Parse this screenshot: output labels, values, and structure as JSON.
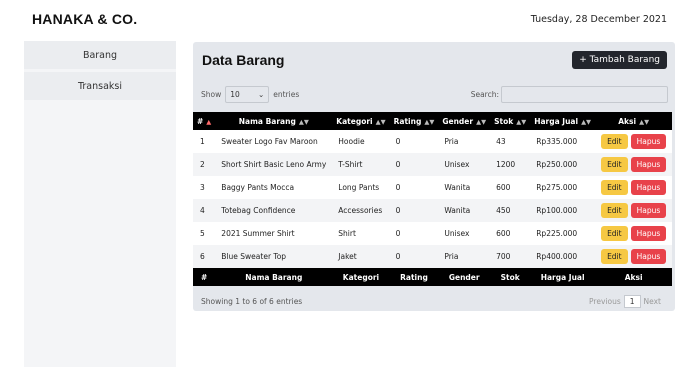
{
  "header": {
    "brand": "HANAKA & CO.",
    "date": "Tuesday, 28 December 2021"
  },
  "sidebar": {
    "items": [
      {
        "label": "Barang"
      },
      {
        "label": "Transaksi"
      }
    ]
  },
  "main": {
    "title": "Data Barang",
    "add_button": "+ Tambah Barang",
    "length": {
      "show": "Show",
      "value": "10",
      "entries": "entries"
    },
    "search_label": "Search:",
    "table": {
      "columns": [
        "#",
        "Nama Barang",
        "Kategori",
        "Rating",
        "Gender",
        "Stok",
        "Harga Jual",
        "Aksi"
      ],
      "rows": [
        [
          "1",
          "Sweater Logo Fav Maroon",
          "Hoodie",
          "0",
          "Pria",
          "43",
          "Rp335.000"
        ],
        [
          "2",
          "Short Shirt Basic Leno Army",
          "T-Shirt",
          "0",
          "Unisex",
          "1200",
          "Rp250.000"
        ],
        [
          "3",
          "Baggy Pants Mocca",
          "Long Pants",
          "0",
          "Wanita",
          "600",
          "Rp275.000"
        ],
        [
          "4",
          "Totebag Confidence",
          "Accessories",
          "0",
          "Wanita",
          "450",
          "Rp100.000"
        ],
        [
          "5",
          "2021 Summer Shirt",
          "Shirt",
          "0",
          "Unisex",
          "600",
          "Rp225.000"
        ],
        [
          "6",
          "Blue Sweater Top",
          "Jaket",
          "0",
          "Pria",
          "700",
          "Rp400.000"
        ]
      ],
      "edit_label": "Edit",
      "delete_label": "Hapus"
    },
    "info": "Showing 1 to 6 of 6 entries",
    "pagination": {
      "previous": "Previous",
      "current": "1",
      "next": "Next"
    }
  }
}
